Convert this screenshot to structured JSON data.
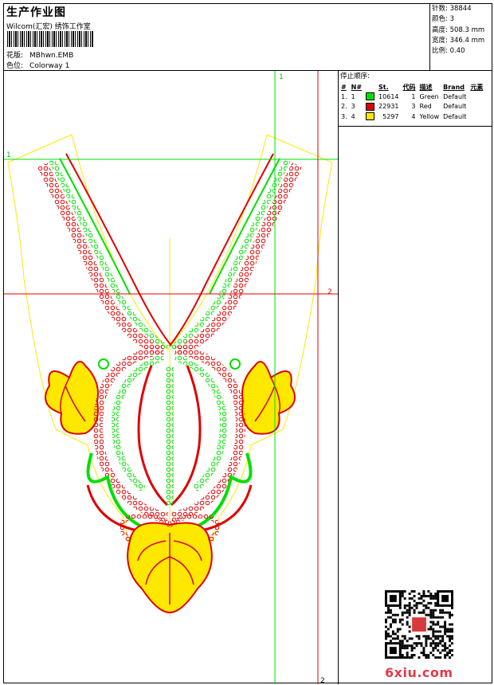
{
  "header": {
    "title": "生产作业图",
    "subtitle": "Wilcom(汇宏) 绣饰工作室",
    "pattern_label": "花版:",
    "pattern_value": "MBhwn.EMB",
    "colorway_label": "色位:",
    "colorway_value": "Colorway 1"
  },
  "info": {
    "stitches": "针数: 38844",
    "colors": "颜色: 3",
    "height": "高度: 508.3 mm",
    "width": "宽度: 346.4 mm",
    "scale": "比例: 0.40"
  },
  "stop_sequence": {
    "caption": "停止顺序:",
    "headers": [
      "#",
      "N#",
      "St.",
      "代码",
      "描述",
      "Brand",
      "元素"
    ],
    "rows": [
      {
        "idx": "1.",
        "n": "1",
        "color": "#00e000",
        "st": "10614",
        "code": "1",
        "desc": "Green",
        "brand": "Default"
      },
      {
        "idx": "2.",
        "n": "3",
        "color": "#e00000",
        "st": "22931",
        "code": "3",
        "desc": "Red",
        "brand": "Default"
      },
      {
        "idx": "3.",
        "n": "4",
        "color": "#ffe800",
        "st": "5297",
        "code": "4",
        "desc": "Yellow",
        "brand": "Default"
      }
    ]
  },
  "guides": {
    "v1": "1",
    "h1": "1",
    "h2": "2",
    "v2": "2"
  },
  "colors": {
    "green": "#00e000",
    "red": "#e00000",
    "yellow": "#ffe800"
  },
  "watermark": {
    "text": "6xiu",
    "suffix": ".com"
  }
}
